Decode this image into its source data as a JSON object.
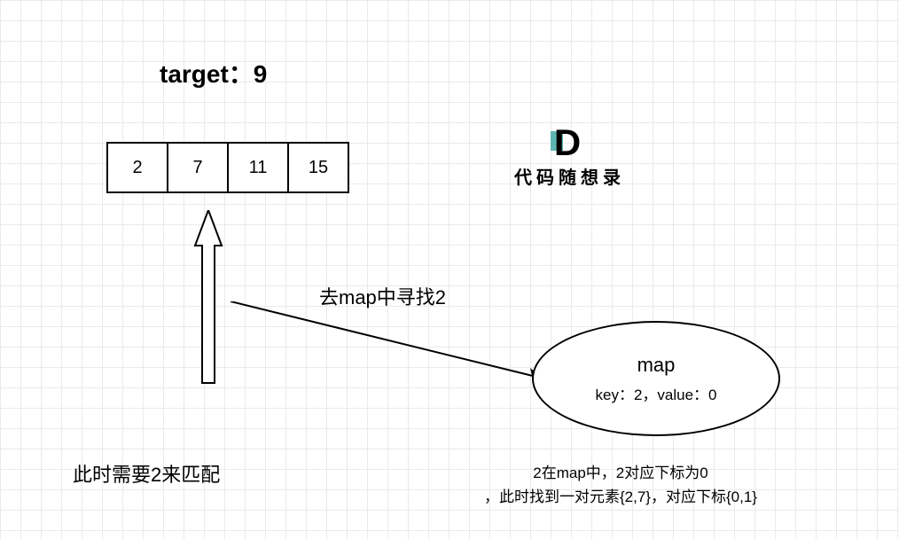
{
  "target_label": "target：9",
  "array": [
    "2",
    "7",
    "11",
    "15"
  ],
  "logo": {
    "letter": "D",
    "text": "代 码 随 想 录"
  },
  "search_label": "去map中寻找2",
  "map": {
    "title": "map",
    "content": "key：2，value：0"
  },
  "need_label": "此时需要2来匹配",
  "result_line1": "2在map中，2对应下标为0",
  "result_line2": "，此时找到一对元素{2,7}，对应下标{0,1}"
}
